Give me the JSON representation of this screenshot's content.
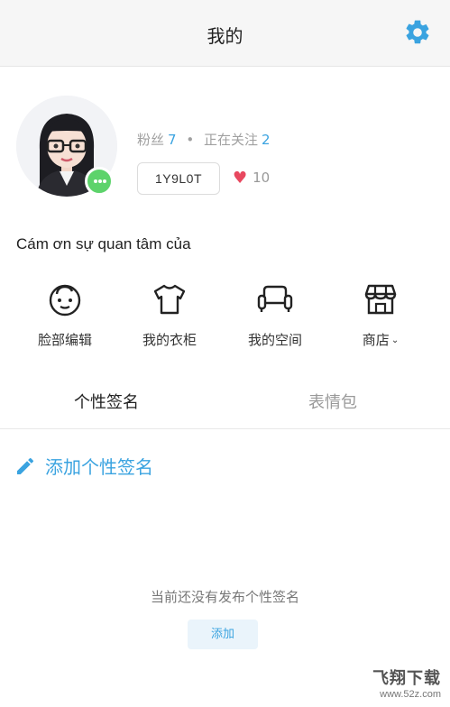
{
  "header": {
    "title": "我的",
    "settings_icon": "gear-icon",
    "accent_color": "#3aa3e0"
  },
  "profile": {
    "followers_label": "粉丝",
    "followers_count": "7",
    "separator": "•",
    "following_label": "正在关注",
    "following_count": "2",
    "user_id": "1Y9L0T",
    "likes_count": "10",
    "status_text": "Cám ơn sự quan tâm của",
    "online": true
  },
  "shortcuts": [
    {
      "label": "脸部编辑",
      "icon": "face-icon"
    },
    {
      "label": "我的衣柜",
      "icon": "tshirt-icon"
    },
    {
      "label": "我的空间",
      "icon": "sofa-icon"
    },
    {
      "label": "商店",
      "icon": "store-icon",
      "has_dropdown": true
    }
  ],
  "tabs": [
    {
      "label": "个性签名",
      "active": true
    },
    {
      "label": "表情包",
      "active": false
    }
  ],
  "signature": {
    "add_label": "添加个性签名",
    "empty_text": "当前还没有发布个性签名",
    "add_button": "添加"
  },
  "watermark": {
    "line1": "飞翔下载",
    "line2": "www.52z.com"
  }
}
